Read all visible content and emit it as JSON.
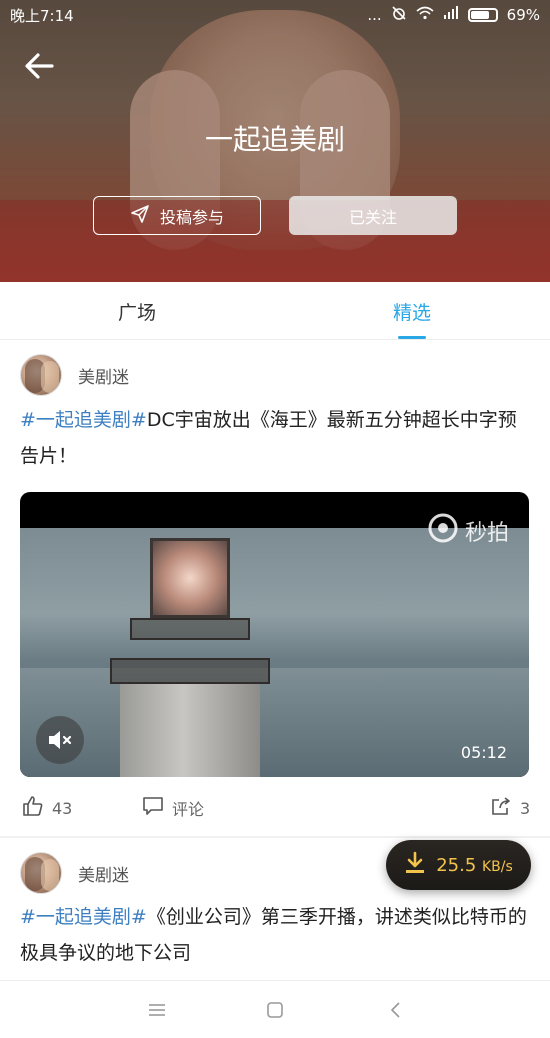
{
  "status_bar": {
    "time": "晚上7:14",
    "dots": "...",
    "battery": "69%"
  },
  "header": {
    "title": "一起追美剧",
    "submit_label": "投稿参与",
    "follow_label": "已关注"
  },
  "tabs": [
    {
      "label": "广场",
      "active": false
    },
    {
      "label": "精选",
      "active": true
    }
  ],
  "posts": [
    {
      "username": "美剧迷",
      "hashtag": "#一起追美剧#",
      "text": "DC宇宙放出《海王》最新五分钟超长中字预告片！",
      "video": {
        "watermark": "秒拍",
        "duration": "05:12"
      },
      "likes": "43",
      "comment_label": "评论",
      "shares": "3"
    },
    {
      "username": "美剧迷",
      "hashtag": "#一起追美剧#",
      "text": "《创业公司》第三季开播，讲述类似比特币的极具争议的地下公司"
    }
  ],
  "download": {
    "speed": "25.5",
    "unit": "KB/s"
  },
  "colors": {
    "accent": "#2aa8e6",
    "hashtag": "#3d7fc1",
    "download": "#f2c34d"
  },
  "icons": [
    "back-arrow-icon",
    "send-icon",
    "mute-icon",
    "like-icon",
    "comment-icon",
    "share-icon",
    "download-icon",
    "menu-icon",
    "home-icon",
    "back-icon"
  ]
}
